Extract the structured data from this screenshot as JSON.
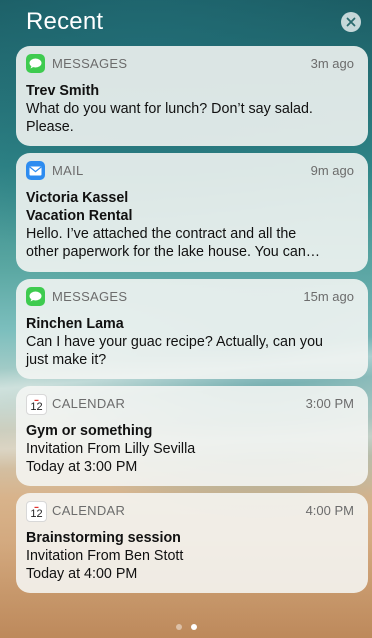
{
  "header": {
    "title": "Recent"
  },
  "notifications": [
    {
      "app": "MESSAGES",
      "time": "3m ago",
      "title": "Trev Smith",
      "lines": [
        "What do you want for lunch? Don’t say salad.",
        "Please."
      ]
    },
    {
      "app": "MAIL",
      "time": "9m ago",
      "title": "Victoria Kassel",
      "subtitle": "Vacation Rental",
      "lines": [
        "Hello. I’ve attached the contract and all the",
        "other paperwork for the lake house. You can…"
      ]
    },
    {
      "app": "MESSAGES",
      "time": "15m ago",
      "title": "Rinchen Lama",
      "lines": [
        "Can I have your guac recipe? Actually, can you",
        "just make it?"
      ]
    },
    {
      "app": "CALENDAR",
      "time": "3:00 PM",
      "icon_day": "12",
      "title": "Gym or something",
      "lines": [
        "Invitation From Lilly Sevilla",
        "Today at 3:00 PM"
      ]
    },
    {
      "app": "CALENDAR",
      "time": "4:00 PM",
      "icon_day": "12",
      "title": "Brainstorming session",
      "lines": [
        "Invitation From Ben Stott",
        "Today at 4:00 PM"
      ]
    }
  ],
  "page_indicator": {
    "count": 2,
    "active": 1
  },
  "colors": {
    "messages": "#3ecb4f",
    "mail": "#2d8cf0",
    "calendar_red": "#e2312c"
  },
  "icons": {
    "messages": "speech-bubble-icon",
    "mail": "envelope-icon",
    "calendar": "calendar-icon",
    "close": "close-icon"
  }
}
